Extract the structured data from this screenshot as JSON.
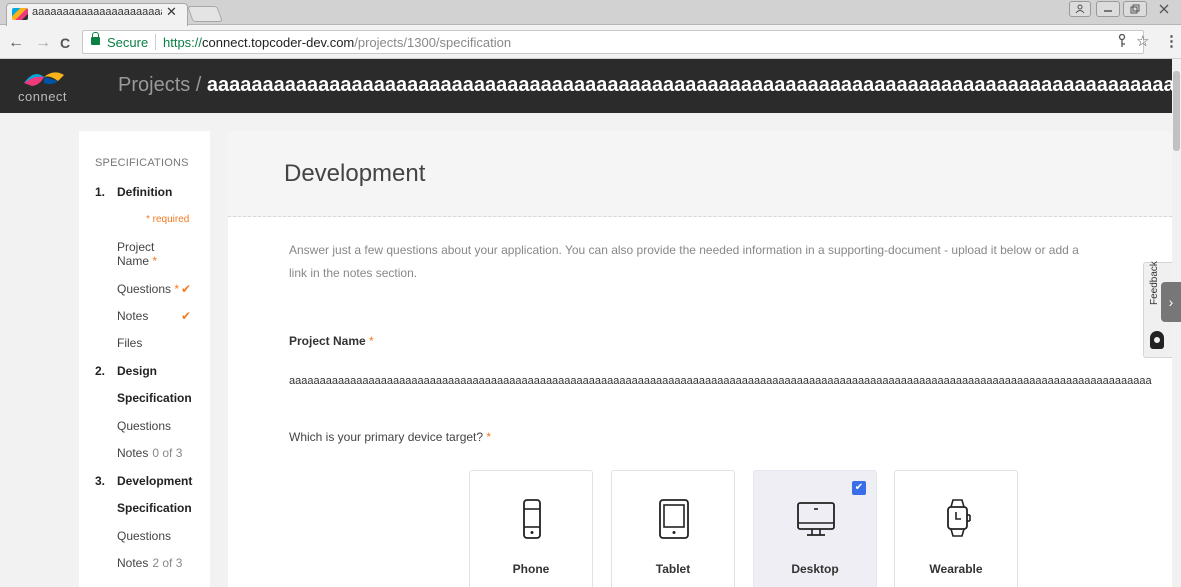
{
  "browser": {
    "tab_title": "aaaaaaaaaaaaaaaaaaaaaaa",
    "tab_close": "✕",
    "url_secure_label": "Secure",
    "url_protocol": "https://",
    "url_host": "connect.topcoder-dev.com",
    "url_path": "/projects/1300/specification",
    "back": "←",
    "forward": "→",
    "reload": "C",
    "star": "☆",
    "menu": "⋮",
    "key": "🔑"
  },
  "app": {
    "logo_text": "connect",
    "breadcrumb_root": "Projects /",
    "project_name": "aaaaaaaaaaaaaaaaaaaaaaaaaaaaaaaaaaaaaaaaaaaaaaaaaaaaaaaaaaaaaaaaaaaaaaaaaaaaaaaaaaaaaaaaaaaaaaaaaa"
  },
  "sidebar": {
    "heading": "SPECIFICATIONS",
    "required_note": "* required",
    "sections": [
      {
        "number": "1.",
        "title_line1": "Definition",
        "title_line2": ""
      },
      {
        "number": "2.",
        "title_line1": "Design",
        "title_line2": "Specification"
      },
      {
        "number": "3.",
        "title_line1": "Development",
        "title_line2": "Specification"
      }
    ],
    "items": {
      "project_name_line1": "Project",
      "project_name_line2": "Name",
      "questions": "Questions",
      "notes": "Notes",
      "files": "Files",
      "design_questions": "Questions",
      "design_notes": "Notes",
      "design_notes_count": "0 of 3",
      "dev_questions": "Questions",
      "dev_notes": "Notes",
      "dev_notes_count": "2 of 3",
      "required_star": "*",
      "check": "✔"
    }
  },
  "main": {
    "title": "Development",
    "intro_line1": "Answer just a few questions about your application. You can also provide the needed information in a supporting-document - upload it below or add a",
    "intro_line2": "link in the notes section.",
    "project_name_label": "Project Name",
    "required_star": "*",
    "project_name_value": "aaaaaaaaaaaaaaaaaaaaaaaaaaaaaaaaaaaaaaaaaaaaaaaaaaaaaaaaaaaaaaaaaaaaaaaaaaaaaaaaaaaaaaaaaaaaaaaaaaaaaaaaaaaaaaaaaaaaaaaaaaaaaaaaaaaaaaaaaaaaa",
    "device_question": "Which is your primary device target?",
    "devices": [
      {
        "label": "Phone",
        "icon": "phone-icon",
        "selected": false
      },
      {
        "label": "Tablet",
        "icon": "tablet-icon",
        "selected": false
      },
      {
        "label": "Desktop",
        "icon": "desktop-icon",
        "selected": true
      },
      {
        "label": "Wearable",
        "icon": "wearable-icon",
        "selected": false
      }
    ],
    "device_check": "✔"
  },
  "feedback": {
    "label": "Feedback",
    "arrow": "›"
  },
  "colors": {
    "accent_orange": "#f47a20",
    "secure_green": "#0b8043",
    "check_blue": "#3a6ee8",
    "header_bg": "#2b2b2b"
  }
}
